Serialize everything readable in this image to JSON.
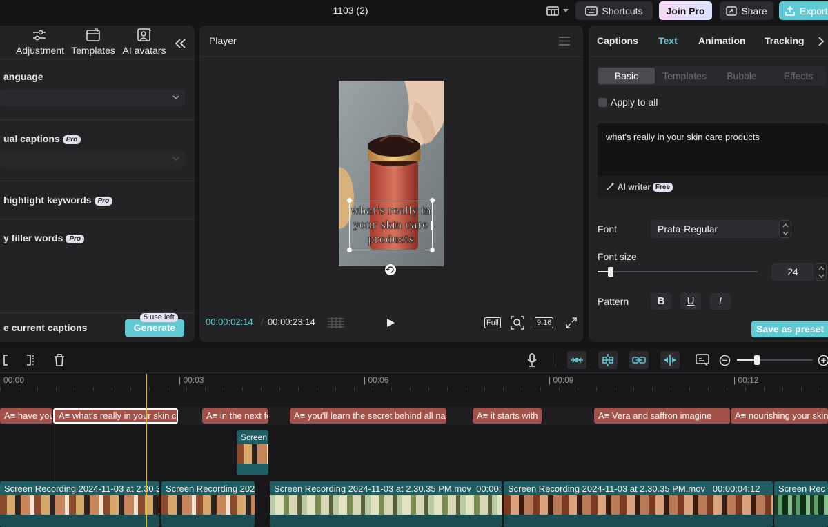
{
  "window": {
    "title": "1103 (2)"
  },
  "topbar": {
    "shortcuts_label": "Shortcuts",
    "join_pro_label": "Join Pro",
    "share_label": "Share",
    "export_label": "Export"
  },
  "left_toolbar": [
    {
      "label": "Adjustment",
      "icon": "sliders-icon"
    },
    {
      "label": "Templates",
      "icon": "templates-icon"
    },
    {
      "label": "AI avatars",
      "icon": "avatar-icon"
    }
  ],
  "auto_captions": {
    "language_label": "anguage",
    "dual_captions_label": "ual captions",
    "highlight_keywords_label": "highlight keywords",
    "filler_words_label": "y filler words",
    "pro_badge": "Pro",
    "current_captions_label": "e current captions",
    "uses_left": "5 use left",
    "generate_label": "Generate"
  },
  "player": {
    "title": "Player",
    "overlay_text": "what's really in your skin care products",
    "current_time": "00:00:02:14",
    "total_time": "00:00:23:14",
    "full_label": "Full",
    "ratio_label": "9:16"
  },
  "right_panel": {
    "tabs": [
      "Captions",
      "Text",
      "Animation",
      "Tracking"
    ],
    "active_tab": "Text",
    "subtabs": [
      "Basic",
      "Templates",
      "Bubble",
      "Effects"
    ],
    "active_subtab": "Basic",
    "apply_to_all": "Apply to all",
    "text_value": "what's really in your skin care products",
    "ai_writer_label": "AI writer",
    "free_badge": "Free",
    "font_label": "Font",
    "font_value": "Prata-Regular",
    "font_size_label": "Font size",
    "font_size_value": "24",
    "font_size_fraction": 0.08,
    "pattern_label": "Pattern",
    "bold_label": "B",
    "underline_label": "U",
    "italic_label": "I",
    "save_preset_label": "Save as preset"
  },
  "timeline": {
    "ruler": [
      "00:00",
      "00:03",
      "00:06",
      "00:09",
      "00:12"
    ],
    "captions": [
      "have you",
      "what's really in your skin c",
      "in the next fe",
      "you'll learn the secret behind all na",
      "it starts with",
      "Vera and saffron imagine",
      "nourishing your skin"
    ],
    "overlay_clip_label": "Screen",
    "video_clips": [
      {
        "label": "Screen Recording 2024-11-03 at 2.30.3"
      },
      {
        "label": "Screen Recording 202"
      },
      {
        "label": "Screen Recording 2024-11-03 at 2.30.35 PM.mov",
        "duration": "00:00:"
      },
      {
        "label": "Screen Recording 2024-11-03 at 2.30.35 PM.mov",
        "duration": "00:00:04:12"
      },
      {
        "label": "Screen Rec"
      }
    ]
  },
  "colors": {
    "accent_teal": "#5fc9d4",
    "caption_clip": "#a4514a",
    "video_clip": "#1f5f63",
    "playhead": "#d8b94a"
  }
}
